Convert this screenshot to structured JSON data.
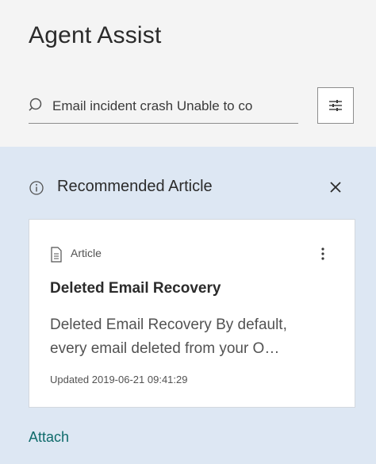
{
  "header": {
    "title": "Agent Assist"
  },
  "search": {
    "value": "Email incident crash Unable to co",
    "search_icon": "search-icon",
    "filter_icon": "sliders-icon"
  },
  "recommendation": {
    "label": "Recommended Article",
    "info_icon": "info-icon",
    "close_icon": "close-icon",
    "card": {
      "type_label": "Article",
      "type_icon": "document-icon",
      "menu_icon": "overflow-menu-icon",
      "title": "Deleted Email Recovery",
      "snippet_line1": "Deleted Email Recovery By default,",
      "snippet_line2": "every email deleted from your O…",
      "updated": "Updated 2019-06-21 09:41:29"
    },
    "attach_label": "Attach"
  },
  "colors": {
    "header_bg": "#f4f4f4",
    "results_bg": "#dde7f3",
    "card_bg": "#ffffff",
    "link": "#0f6b6b",
    "text": "#2b2b2b"
  }
}
